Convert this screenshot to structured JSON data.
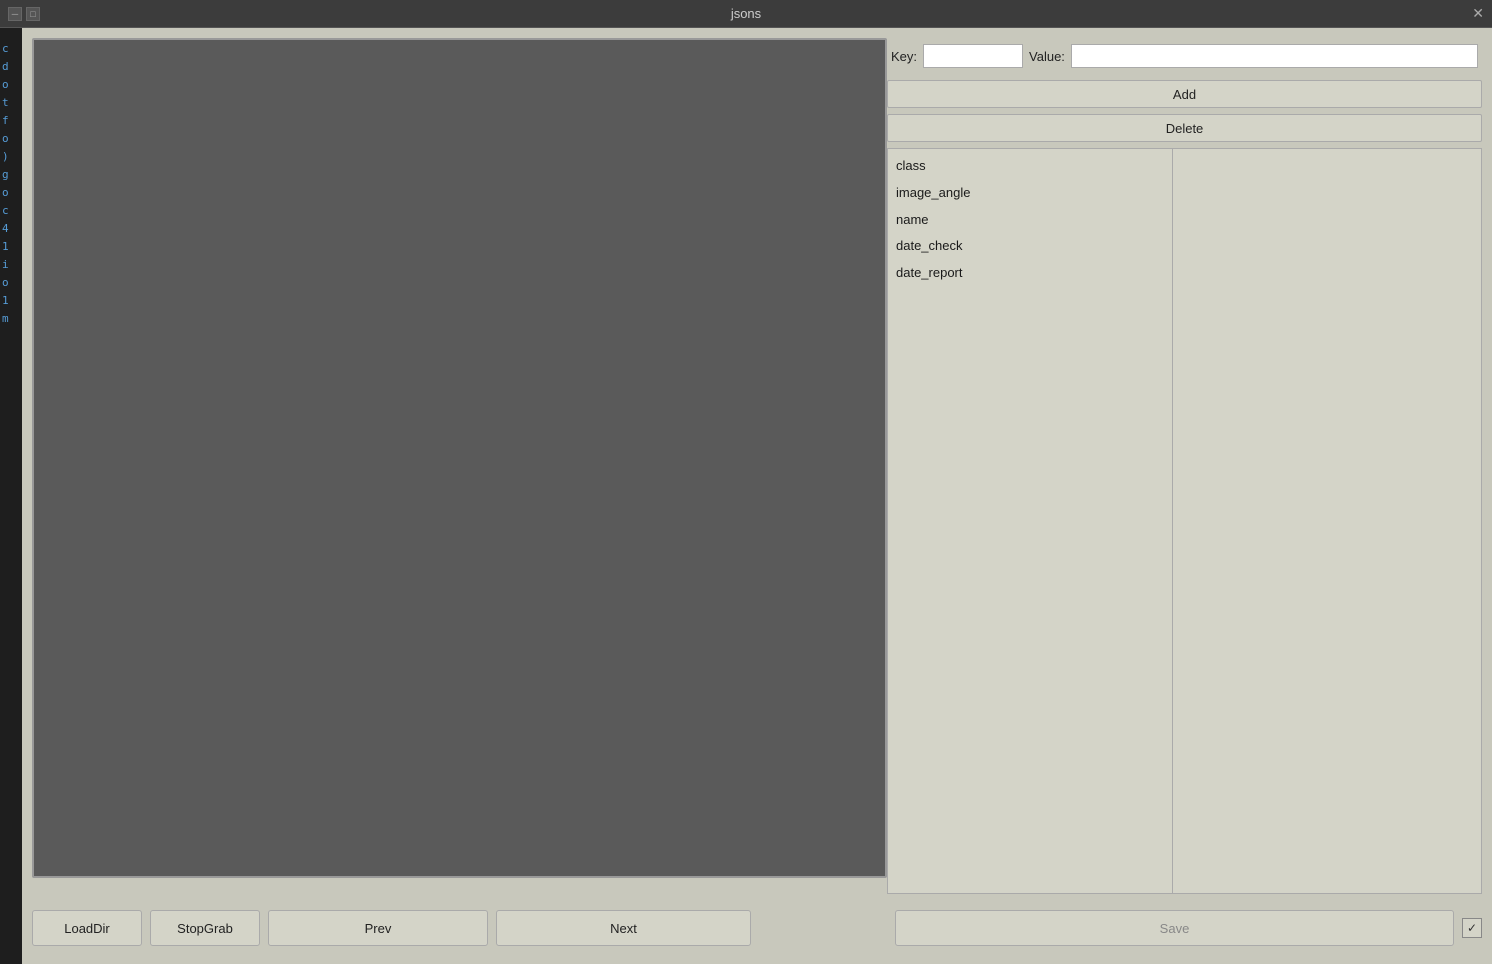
{
  "titlebar": {
    "title": "jsons",
    "close_label": "✕"
  },
  "controls": {
    "key_label": "Key:",
    "value_label": "Value:",
    "key_placeholder": "",
    "value_placeholder": "",
    "add_label": "Add",
    "delete_label": "Delete",
    "save_label": "Save"
  },
  "keys_list": {
    "items": [
      "class",
      "image_angle",
      "name",
      "date_check",
      "date_report"
    ]
  },
  "toolbar": {
    "loaddir_label": "LoadDir",
    "stopgrab_label": "StopGrab",
    "prev_label": "Prev",
    "next_label": "Next"
  },
  "code_lines": [
    "c",
    "d",
    "o",
    "t",
    "f",
    "o",
    ")",
    "g",
    "o",
    "c",
    "4",
    "1",
    "i",
    "o",
    "1",
    "m"
  ]
}
